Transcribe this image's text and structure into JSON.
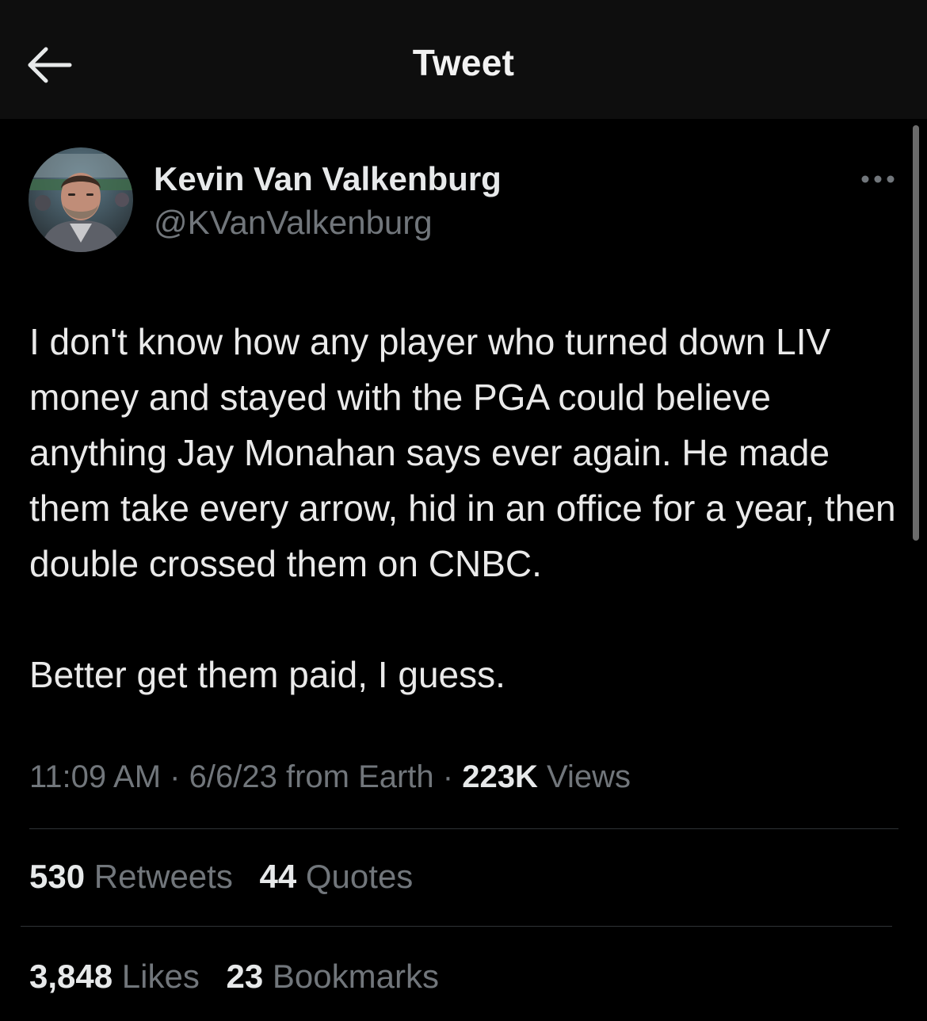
{
  "header": {
    "back_icon": "arrow-left-icon",
    "title": "Tweet"
  },
  "author": {
    "name": "Kevin Van Valkenburg",
    "handle": "@KVanValkenburg",
    "more_icon": "more-horizontal-icon"
  },
  "tweet": {
    "paragraphs": [
      "I don't know how any player who turned down LIV money and stayed with the PGA could believe anything Jay Monahan says ever again. He made them take every arrow, hid in an office for a year, then double crossed them on CNBC.",
      "Better get them paid, I guess."
    ]
  },
  "meta": {
    "time": "11:09 AM",
    "separator": "·",
    "date_source": "6/6/23 from Earth",
    "views_count": "223K",
    "views_label": "Views"
  },
  "stats": {
    "retweets_count": "530",
    "retweets_label": "Retweets",
    "quotes_count": "44",
    "quotes_label": "Quotes",
    "likes_count": "3,848",
    "likes_label": "Likes",
    "bookmarks_count": "23",
    "bookmarks_label": "Bookmarks"
  },
  "colors": {
    "background": "#000000",
    "header_background": "#0e0e0e",
    "primary_text": "#e7e9ea",
    "secondary_text": "#71767b",
    "divider": "#2f3336"
  }
}
